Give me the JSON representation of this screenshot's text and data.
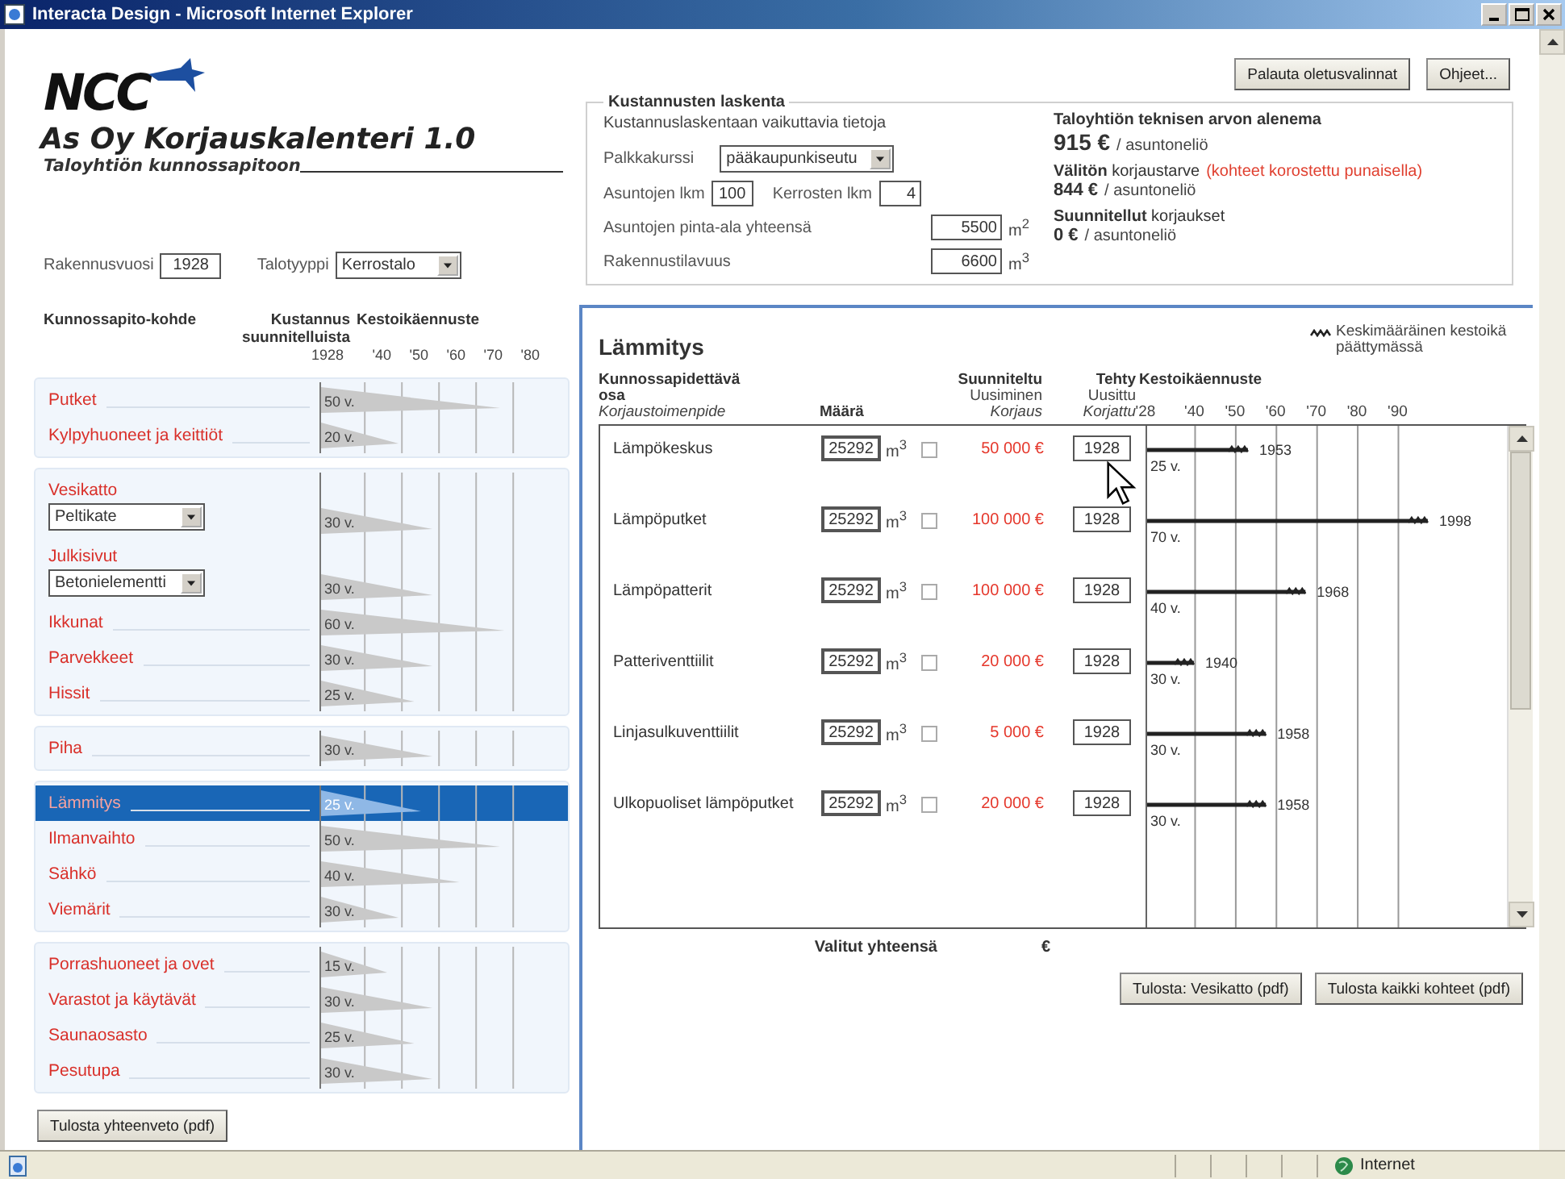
{
  "window": {
    "title": "Interacta Design - Microsoft Internet Explorer"
  },
  "header": {
    "logo": "NCC",
    "app_title": "As Oy Korjauskalenteri 1.0",
    "subtitle": "Taloyhtiön kunnossapitoon"
  },
  "building": {
    "year_label": "Rakennusvuosi",
    "year": "1928",
    "type_label": "Talotyyppi",
    "type": "Kerrostalo"
  },
  "list_headers": {
    "target": "Kunnossapito-kohde",
    "cost": "Kustannus suunnitelluista",
    "forecast": "Kestoikäennuste",
    "scale": [
      "1928",
      "'40",
      "'50",
      "'60",
      "'70",
      "'80"
    ]
  },
  "groups": [
    {
      "items": [
        {
          "kind": "plain",
          "label": "Putket",
          "age": "50 v.",
          "level": 0.8,
          "selected": false
        },
        {
          "kind": "plain",
          "label": "Kylpyhuoneet ja keittiöt",
          "age": "20 v.",
          "level": 0.35,
          "selected": false
        }
      ]
    },
    {
      "items": [
        {
          "kind": "select",
          "label": "Vesikatto",
          "choice": "Peltikate",
          "age": "30 v.",
          "level": 0.5,
          "selected": false
        },
        {
          "kind": "select",
          "label": "Julkisivut",
          "choice": "Betonielementti",
          "age": "30 v.",
          "level": 0.5,
          "selected": false
        },
        {
          "kind": "plain",
          "label": "Ikkunat",
          "age": "60 v.",
          "level": 0.82,
          "selected": false
        },
        {
          "kind": "plain",
          "label": "Parvekkeet",
          "age": "30 v.",
          "level": 0.5,
          "selected": false
        },
        {
          "kind": "plain",
          "label": "Hissit",
          "age": "25 v.",
          "level": 0.42,
          "selected": false
        }
      ]
    },
    {
      "items": [
        {
          "kind": "plain",
          "label": "Piha",
          "age": "30 v.",
          "level": 0.5,
          "selected": false
        }
      ]
    },
    {
      "items": [
        {
          "kind": "plain",
          "label": "Lämmitys",
          "age": "25 v.",
          "level": 0.45,
          "selected": true
        },
        {
          "kind": "plain",
          "label": "Ilmanvaihto",
          "age": "50 v.",
          "level": 0.8,
          "selected": false
        },
        {
          "kind": "plain",
          "label": "Sähkö",
          "age": "40 v.",
          "level": 0.62,
          "selected": false
        },
        {
          "kind": "plain",
          "label": "Viemärit",
          "age": "30 v.",
          "level": 0.35,
          "selected": false
        }
      ]
    },
    {
      "items": [
        {
          "kind": "plain",
          "label": "Porrashuoneet ja ovet",
          "age": "15 v.",
          "level": 0.3,
          "selected": false
        },
        {
          "kind": "plain",
          "label": "Varastot ja käytävät",
          "age": "30 v.",
          "level": 0.5,
          "selected": false
        },
        {
          "kind": "plain",
          "label": "Saunaosasto",
          "age": "25 v.",
          "level": 0.42,
          "selected": false
        },
        {
          "kind": "plain",
          "label": "Pesutupa",
          "age": "30 v.",
          "level": 0.5,
          "selected": false
        }
      ]
    }
  ],
  "summary_button": "Tulosta yhteenveto (pdf)",
  "top_buttons": [
    "Palauta oletusvalinnat",
    "Ohjeet..."
  ],
  "costs": {
    "legend": "Kustannusten laskenta",
    "intro": "Kustannuslaskentaan vaikuttavia tietoja",
    "wage_label": "Palkkakurssi",
    "wage": "pääkaupunkiseutu",
    "flats_label": "Asuntojen lkm",
    "flats": "100",
    "floors_label": "Kerrosten lkm",
    "floors": "4",
    "area_label": "Asuntojen pinta-ala yhteensä",
    "area": "5500",
    "area_unit": "m$^{2}$",
    "volume_label": "Rakennustilavuus",
    "volume": "6600",
    "volume_unit": "m$^{3}$",
    "results": [
      {
        "heading": "Taloyhtiön teknisen arvon alenema",
        "value": "915 €",
        "unit": "/ asuntoneliö"
      },
      {
        "heading": "**Välitön** korjaustarve",
        "note": "(kohteet korostettu punaisella)",
        "value": "844 €",
        "unit": "/ asuntoneliö"
      },
      {
        "heading": "**Suunnitellut** korjaukset",
        "value": "0 €",
        "unit": "/ asuntoneliö"
      }
    ]
  },
  "detail": {
    "title": "Lämmitys",
    "legend": "Keskimääräinen kestoikä päättymässä",
    "col_part": "Kunnossapidettävä osa",
    "col_action": "Korjaustoimenpide",
    "col_amount": "Määrä",
    "col_planned": "Suunniteltu",
    "col_renew": "Uusiminen",
    "col_repair": "Korjaus",
    "col_done": "Tehty",
    "col_renewed": "Uusittu",
    "col_repaired": "Korjattu",
    "col_forecast": "Kestoikäennuste",
    "scale": [
      "'28",
      "'40",
      "'50",
      "'60",
      "'70",
      "'80",
      "'90"
    ],
    "rows": [
      {
        "name": "Lämpökeskus",
        "amount": "25292",
        "unit": "m$^{3}$",
        "checked": false,
        "cost": "50 000 €",
        "year": "1928",
        "age": "25 v.",
        "end_year": "1953",
        "level": 0.28
      },
      {
        "name": "Lämpöputket",
        "amount": "25292",
        "unit": "m$^{3}$",
        "checked": false,
        "cost": "100 000 €",
        "year": "1928",
        "age": "70 v.",
        "end_year": "1998",
        "level": 0.78
      },
      {
        "name": "Lämpöpatterit",
        "amount": "25292",
        "unit": "m$^{3}$",
        "checked": false,
        "cost": "100 000 €",
        "year": "1928",
        "age": "40 v.",
        "end_year": "1968",
        "level": 0.44
      },
      {
        "name": "Patteriventtiilit",
        "amount": "25292",
        "unit": "m$^{3}$",
        "checked": false,
        "cost": "20 000 €",
        "year": "1928",
        "age": "30 v.",
        "end_year": "1940",
        "level": 0.13
      },
      {
        "name": "Linjasulkuventtiilit",
        "amount": "25292",
        "unit": "m$^{3}$",
        "checked": false,
        "cost": "5 000 €",
        "year": "1928",
        "age": "30 v.",
        "end_year": "1958",
        "level": 0.33
      },
      {
        "name": "Ulkopuoliset lämpöputket",
        "amount": "25292",
        "unit": "m$^{3}$",
        "checked": false,
        "cost": "20 000 €",
        "year": "1928",
        "age": "30 v.",
        "end_year": "1958",
        "level": 0.33
      }
    ],
    "total_label": "Valitut yhteensä",
    "total_unit": "€",
    "buttons": [
      "Tulosta: Vesikatto (pdf)",
      "Tulosta kaikki kohteet (pdf)"
    ]
  },
  "status_bar": {
    "zone": "Internet"
  }
}
